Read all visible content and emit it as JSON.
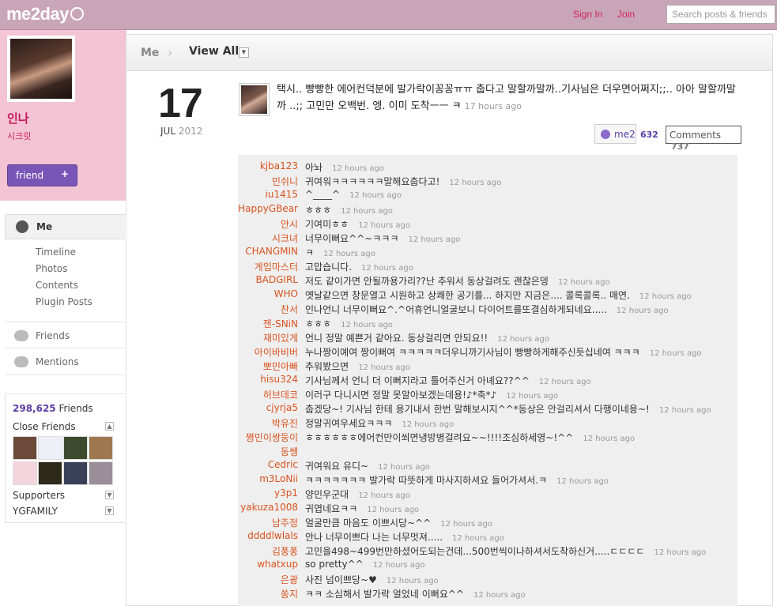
{
  "header": {
    "logo_text": "me2day",
    "signin_label": "Sign In",
    "join_label": "Join",
    "search_placeholder": "Search posts & friends"
  },
  "profile": {
    "name": "인나",
    "subtitle": "시크릿",
    "friend_button_label": "friend",
    "friend_button_plus": "+"
  },
  "nav": {
    "me_label": "Me",
    "sub_items": [
      "Timeline",
      "Photos",
      "Contents",
      "Plugin Posts"
    ],
    "friends_label": "Friends",
    "mentions_label": "Mentions"
  },
  "friends_box": {
    "count": "298,625",
    "count_label": "Friends",
    "close_friends_label": "Close Friends",
    "supporters_label": "Supporters",
    "group_label": "YGFAMILY"
  },
  "tabs": {
    "me_label": "Me",
    "chevron": "›",
    "view_all_label": "View All",
    "dropdown_arrow": "▼"
  },
  "post": {
    "day": "17",
    "month": "JUL",
    "year": "2012",
    "text": "택시.. 빵빵한 에어컨덕분에 발가락이꽁꽁ㅠㅠ 춥다고 말할까말까..기사님은 더우면어쩌지;;.. 아아 말할까말까 ..;; 고민만 오백번. 엥. 이미 도착ㅡㅡ ㅋ",
    "time": "17 hours ago",
    "me2_label": "me2",
    "me2_count": "632",
    "comments_label": "Comments",
    "comments_count": "737"
  },
  "comments": [
    {
      "user": "kjba123",
      "text": "아놔",
      "time": "12 hours ago"
    },
    {
      "user": "민쉬니",
      "text": "귀여워ㅋㅋㅋㅋㅋㅋ말해요춥다고!",
      "time": "12 hours ago"
    },
    {
      "user": "iu1415",
      "text": "^____^",
      "time": "12 hours ago"
    },
    {
      "user": "HappyGBear",
      "text": "ㅎㅎㅎ",
      "time": "12 hours ago"
    },
    {
      "user": "안시",
      "text": "기여미ㅎㅎ",
      "time": "12 hours ago"
    },
    {
      "user": "시크녀",
      "text": "너무이뻐요^^~ㅋㅋㅋ",
      "time": "12 hours ago"
    },
    {
      "user": "CHANGMIN",
      "text": "ㅋ",
      "time": "12 hours ago"
    },
    {
      "user": "게임마스터",
      "text": "고맙습니다.",
      "time": "12 hours ago"
    },
    {
      "user": "BADGIRL",
      "text": "저도 같이가면 안될까용가리??난 추워서 동상걸려도 괜찮은뎅",
      "time": "12 hours ago"
    },
    {
      "user": "WHO",
      "text": "옛날같으면 창문열고 시원하고 상쾌한 공기를... 하지만 지금은.... 콜록콜록.. 매연.",
      "time": "12 hours ago"
    },
    {
      "user": "찬서",
      "text": "인나언니 너무이뻐요^.^어휴언니얼굴보니 다이어트를또결심하게되네요.....",
      "time": "12 hours ago"
    },
    {
      "user": "젠-SNiN",
      "text": "ㅎㅎㅎ",
      "time": "12 hours ago"
    },
    {
      "user": "재미있게",
      "text": "언니 정말 예쁜거 같아요. 동상걸리면 안되요!!",
      "time": "12 hours ago"
    },
    {
      "user": "아이바비버",
      "text": "누나짱이예여 짱이뻐여 ㅋㅋㅋㅋㅋ더우니까기사님이 빵빵하게해주신듯십네여 ㅋㅋㅋ",
      "time": "12 hours ago"
    },
    {
      "user": "뽀민아빠",
      "text": "추워봤으면",
      "time": "12 hours ago"
    },
    {
      "user": "hisu324",
      "text": "기사님께서 언니 더 이뻐지라고 틀어주신거 아녜요??^^",
      "time": "12 hours ago"
    },
    {
      "user": "허브데코",
      "text": "이러구 다니시면 정말 못알아보겠는데용!♪*축*♪",
      "time": "12 hours ago"
    },
    {
      "user": "cjyrja5",
      "text": "춥겠당~! 기사님 한테 용기내서 한번 말해보시지^^*동상은 안걸리셔서 다행이네용~!",
      "time": "12 hours ago"
    },
    {
      "user": "박유진",
      "text": "정말귀여우세요ㅋㅋㅋ",
      "time": "12 hours ago"
    },
    {
      "user": "쪙민이쌍둥이",
      "text": "ㅎㅎㅎㅎㅎㅎ에어컨만이쐬면냉방병걸려요~~!!!!조심하세영~!^^",
      "time": "12 hours ago"
    },
    {
      "user": "동쌩",
      "text": "",
      "time": ""
    },
    {
      "user": "Cedric",
      "text": "귀여워요 유디~",
      "time": "12 hours ago"
    },
    {
      "user": "m3LoNii",
      "text": "ㅋㅋㅋㅋㅋㅋㅋ 발가락 따뜻하게 마사지하셔요 들어가셔서.ㅋ",
      "time": "12 hours ago"
    },
    {
      "user": "y3p1",
      "text": "양민우군대",
      "time": "12 hours ago"
    },
    {
      "user": "yakuza1008",
      "text": "귀엽네요ㅋㅋ",
      "time": "12 hours ago"
    },
    {
      "user": "남주정",
      "text": "얼굴만큼 마음도 이쁘시당~^^",
      "time": "12 hours ago"
    },
    {
      "user": "ddddlwlals",
      "text": "안나 너무이쁘다 나는 너무멋져.....",
      "time": "12 hours ago"
    },
    {
      "user": "김퐁퐁",
      "text": "고민을498~499번만하셨어도되는건데...500번씩이나하셔서도착하신거.....ㄷㄷㄷㄷ",
      "time": "12 hours ago"
    },
    {
      "user": "whatxup",
      "text": "so pretty^^",
      "time": "12 hours ago"
    },
    {
      "user": "은광",
      "text": "사진 넘이쁘당~♥",
      "time": "12 hours ago"
    },
    {
      "user": "쏭지",
      "text": "ㅋㅋ 소심해서 발가락 얼었네 이뻐요^^",
      "time": "12 hours ago"
    }
  ]
}
